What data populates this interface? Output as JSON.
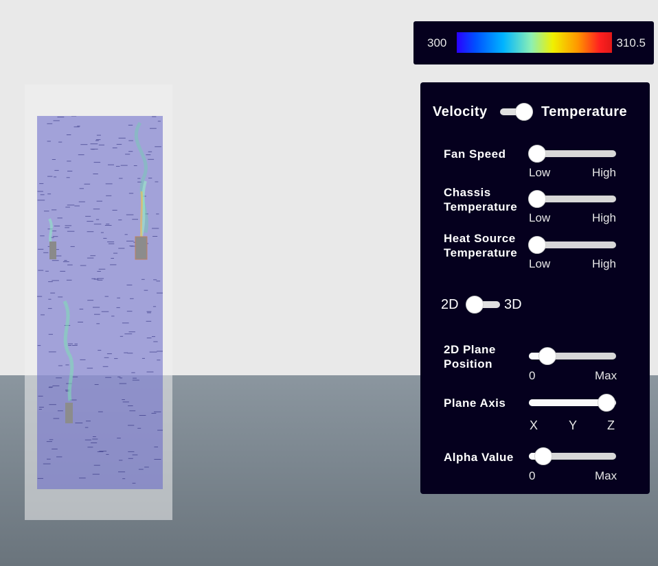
{
  "colorbar": {
    "min_label": "300",
    "max_label": "310.5"
  },
  "controls": {
    "mode_toggle": {
      "left_label": "Velocity",
      "right_label": "Temperature",
      "value": "Temperature"
    },
    "fan_speed": {
      "label": "Fan Speed",
      "low": "Low",
      "high": "High",
      "value": 0
    },
    "chassis_temperature": {
      "label": "Chassis",
      "label2": "Temperature",
      "low": "Low",
      "high": "High",
      "value": 0
    },
    "heat_source_temperature": {
      "label": "Heat Source",
      "label2": "Temperature",
      "low": "Low",
      "high": "High",
      "value": 0
    },
    "dimension_toggle": {
      "left_label": "2D",
      "right_label": "3D",
      "value": "2D"
    },
    "plane_position": {
      "label": "2D Plane",
      "label2": "Position",
      "min": "0",
      "max": "Max",
      "value": 0.15
    },
    "plane_axis": {
      "label": "Plane Axis",
      "options": [
        "X",
        "Y",
        "Z"
      ],
      "value": "Z"
    },
    "alpha_value": {
      "label": "Alpha Value",
      "min": "0",
      "max": "Max",
      "value": 0.12
    }
  },
  "colors": {
    "panel_bg": "#05001e",
    "plane_tint": "#6464c8"
  }
}
